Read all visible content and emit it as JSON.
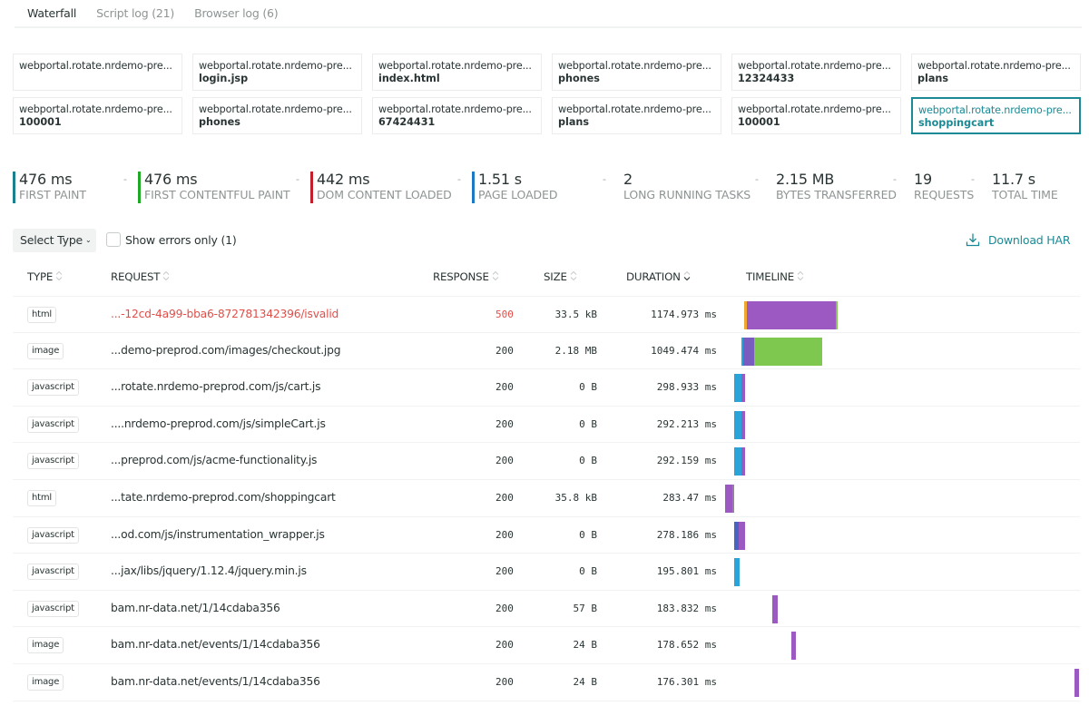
{
  "tabs": [
    {
      "label": "Waterfall",
      "active": true
    },
    {
      "label": "Script log (21)",
      "active": false
    },
    {
      "label": "Browser log (6)",
      "active": false
    }
  ],
  "pages": [
    {
      "host": "webportal.rotate.nrdemo-pre...",
      "path": "",
      "selected": false
    },
    {
      "host": "webportal.rotate.nrdemo-pre...",
      "path": "login.jsp",
      "selected": false
    },
    {
      "host": "webportal.rotate.nrdemo-pre...",
      "path": "index.html",
      "selected": false
    },
    {
      "host": "webportal.rotate.nrdemo-pre...",
      "path": "phones",
      "selected": false
    },
    {
      "host": "webportal.rotate.nrdemo-pre...",
      "path": "12324433",
      "selected": false
    },
    {
      "host": "webportal.rotate.nrdemo-pre...",
      "path": "plans",
      "selected": false
    },
    {
      "host": "webportal.rotate.nrdemo-pre...",
      "path": "100001",
      "selected": false
    },
    {
      "host": "webportal.rotate.nrdemo-pre...",
      "path": "phones",
      "selected": false
    },
    {
      "host": "webportal.rotate.nrdemo-pre...",
      "path": "67424431",
      "selected": false
    },
    {
      "host": "webportal.rotate.nrdemo-pre...",
      "path": "plans",
      "selected": false
    },
    {
      "host": "webportal.rotate.nrdemo-pre...",
      "path": "100001",
      "selected": false
    },
    {
      "host": "webportal.rotate.nrdemo-pre...",
      "path": "shoppingcart",
      "selected": true
    }
  ],
  "metrics": [
    {
      "value": "476 ms",
      "label": "FIRST PAINT",
      "color": "#1a7f8e",
      "dash": "-"
    },
    {
      "value": "476 ms",
      "label": "FIRST CONTENTFUL PAINT",
      "color": "#1ea824",
      "dash": "-"
    },
    {
      "value": "442 ms",
      "label": "DOM CONTENT LOADED",
      "color": "#c21f2b",
      "dash": "-"
    },
    {
      "value": "1.51 s",
      "label": "PAGE LOADED",
      "color": "#1e79c4",
      "dash": "-"
    },
    {
      "value": "2",
      "label": "LONG RUNNING TASKS",
      "color": "",
      "dash": "-"
    },
    {
      "value": "2.15 MB",
      "label": "BYTES TRANSFERRED",
      "color": "",
      "dash": "-"
    },
    {
      "value": "19",
      "label": "REQUESTS",
      "color": "",
      "dash": "-"
    },
    {
      "value": "11.7 s",
      "label": "TOTAL TIME",
      "color": "",
      "dash": "-"
    }
  ],
  "toolbar": {
    "select_type": "Select Type",
    "show_errors": "Show errors only (1)",
    "show_errors_checked": false,
    "download": "Download HAR"
  },
  "columns": {
    "type": "TYPE",
    "request": "REQUEST",
    "response": "RESPONSE",
    "size": "SIZE",
    "duration": "DURATION",
    "timeline": "TIMELINE"
  },
  "colors": {
    "accent": "#1b8a94",
    "error": "#df4f4a",
    "timeline_purple": "#9b59c1",
    "timeline_green": "#7ec850",
    "timeline_blue": "#2aa3d8",
    "timeline_indigo": "#4a63c0",
    "timeline_orange": "#f0a830"
  },
  "requests": [
    {
      "type": "html",
      "request": "...-12cd-4a99-bba6-872781342396/isvalid",
      "response": "500",
      "size": "33.5 kB",
      "duration": "1174.973 ms",
      "error": true,
      "timeline": [
        {
          "start": 0.0,
          "len": 0.003,
          "color": "#f0a830"
        },
        {
          "start": 0.003,
          "len": 0.098,
          "color": "#9b59c1"
        },
        {
          "start": 0.101,
          "len": 0.002,
          "color": "#7ec850"
        }
      ]
    },
    {
      "type": "image",
      "request": "...demo-preprod.com/images/checkout.jpg",
      "response": "200",
      "size": "2.18 MB",
      "duration": "1049.474 ms",
      "error": false,
      "timeline": [
        {
          "start": -0.003,
          "len": 0.0015,
          "color": "#2aa3d8"
        },
        {
          "start": -0.0015,
          "len": 0.012,
          "color": "#7a5cc0"
        },
        {
          "start": 0.0105,
          "len": 0.075,
          "color": "#7ec850"
        }
      ]
    },
    {
      "type": "javascript",
      "request": "...rotate.nrdemo-preprod.com/js/cart.js",
      "response": "200",
      "size": "0 B",
      "duration": "298.933 ms",
      "error": false,
      "timeline": [
        {
          "start": -0.011,
          "len": 0.0075,
          "color": "#2aa3d8"
        },
        {
          "start": -0.0035,
          "len": 0.0045,
          "color": "#9b59c1"
        }
      ]
    },
    {
      "type": "javascript",
      "request": "....nrdemo-preprod.com/js/simpleCart.js",
      "response": "200",
      "size": "0 B",
      "duration": "292.213 ms",
      "error": false,
      "timeline": [
        {
          "start": -0.011,
          "len": 0.0075,
          "color": "#2aa3d8"
        },
        {
          "start": -0.0035,
          "len": 0.0045,
          "color": "#9b59c1"
        }
      ]
    },
    {
      "type": "javascript",
      "request": "...preprod.com/js/acme-functionality.js",
      "response": "200",
      "size": "0 B",
      "duration": "292.159 ms",
      "error": false,
      "timeline": [
        {
          "start": -0.011,
          "len": 0.0075,
          "color": "#2aa3d8"
        },
        {
          "start": -0.0035,
          "len": 0.0045,
          "color": "#9b59c1"
        }
      ]
    },
    {
      "type": "html",
      "request": "...tate.nrdemo-preprod.com/shoppingcart",
      "response": "200",
      "size": "35.8 kB",
      "duration": "283.47 ms",
      "error": false,
      "timeline": [
        {
          "start": -0.021,
          "len": 0.008,
          "color": "#9b59c1"
        },
        {
          "start": -0.013,
          "len": 0.0015,
          "color": "#8a8a8a"
        }
      ]
    },
    {
      "type": "javascript",
      "request": "...od.com/js/instrumentation_wrapper.js",
      "response": "200",
      "size": "0 B",
      "duration": "278.186 ms",
      "error": false,
      "timeline": [
        {
          "start": -0.011,
          "len": 0.0045,
          "color": "#4a63c0"
        },
        {
          "start": -0.0065,
          "len": 0.0075,
          "color": "#9b59c1"
        }
      ]
    },
    {
      "type": "javascript",
      "request": "...jax/libs/jquery/1.12.4/jquery.min.js",
      "response": "200",
      "size": "0 B",
      "duration": "195.801 ms",
      "error": false,
      "timeline": [
        {
          "start": -0.011,
          "len": 0.0055,
          "color": "#2aa3d8"
        }
      ]
    },
    {
      "type": "javascript",
      "request": "bam.nr-data.net/1/14cdaba356",
      "response": "200",
      "size": "57 B",
      "duration": "183.832 ms",
      "error": false,
      "timeline": [
        {
          "start": 0.031,
          "len": 0.0055,
          "color": "#9b59c1"
        }
      ]
    },
    {
      "type": "image",
      "request": "bam.nr-data.net/events/1/14cdaba356",
      "response": "200",
      "size": "24 B",
      "duration": "178.652 ms",
      "error": false,
      "timeline": [
        {
          "start": 0.0515,
          "len": 0.0055,
          "color": "#9b59c1"
        }
      ]
    },
    {
      "type": "image",
      "request": "bam.nr-data.net/events/1/14cdaba356",
      "response": "200",
      "size": "24 B",
      "duration": "176.301 ms",
      "error": false,
      "timeline": [
        {
          "start": 0.3635,
          "len": 0.0055,
          "color": "#9b59c1"
        }
      ]
    }
  ]
}
